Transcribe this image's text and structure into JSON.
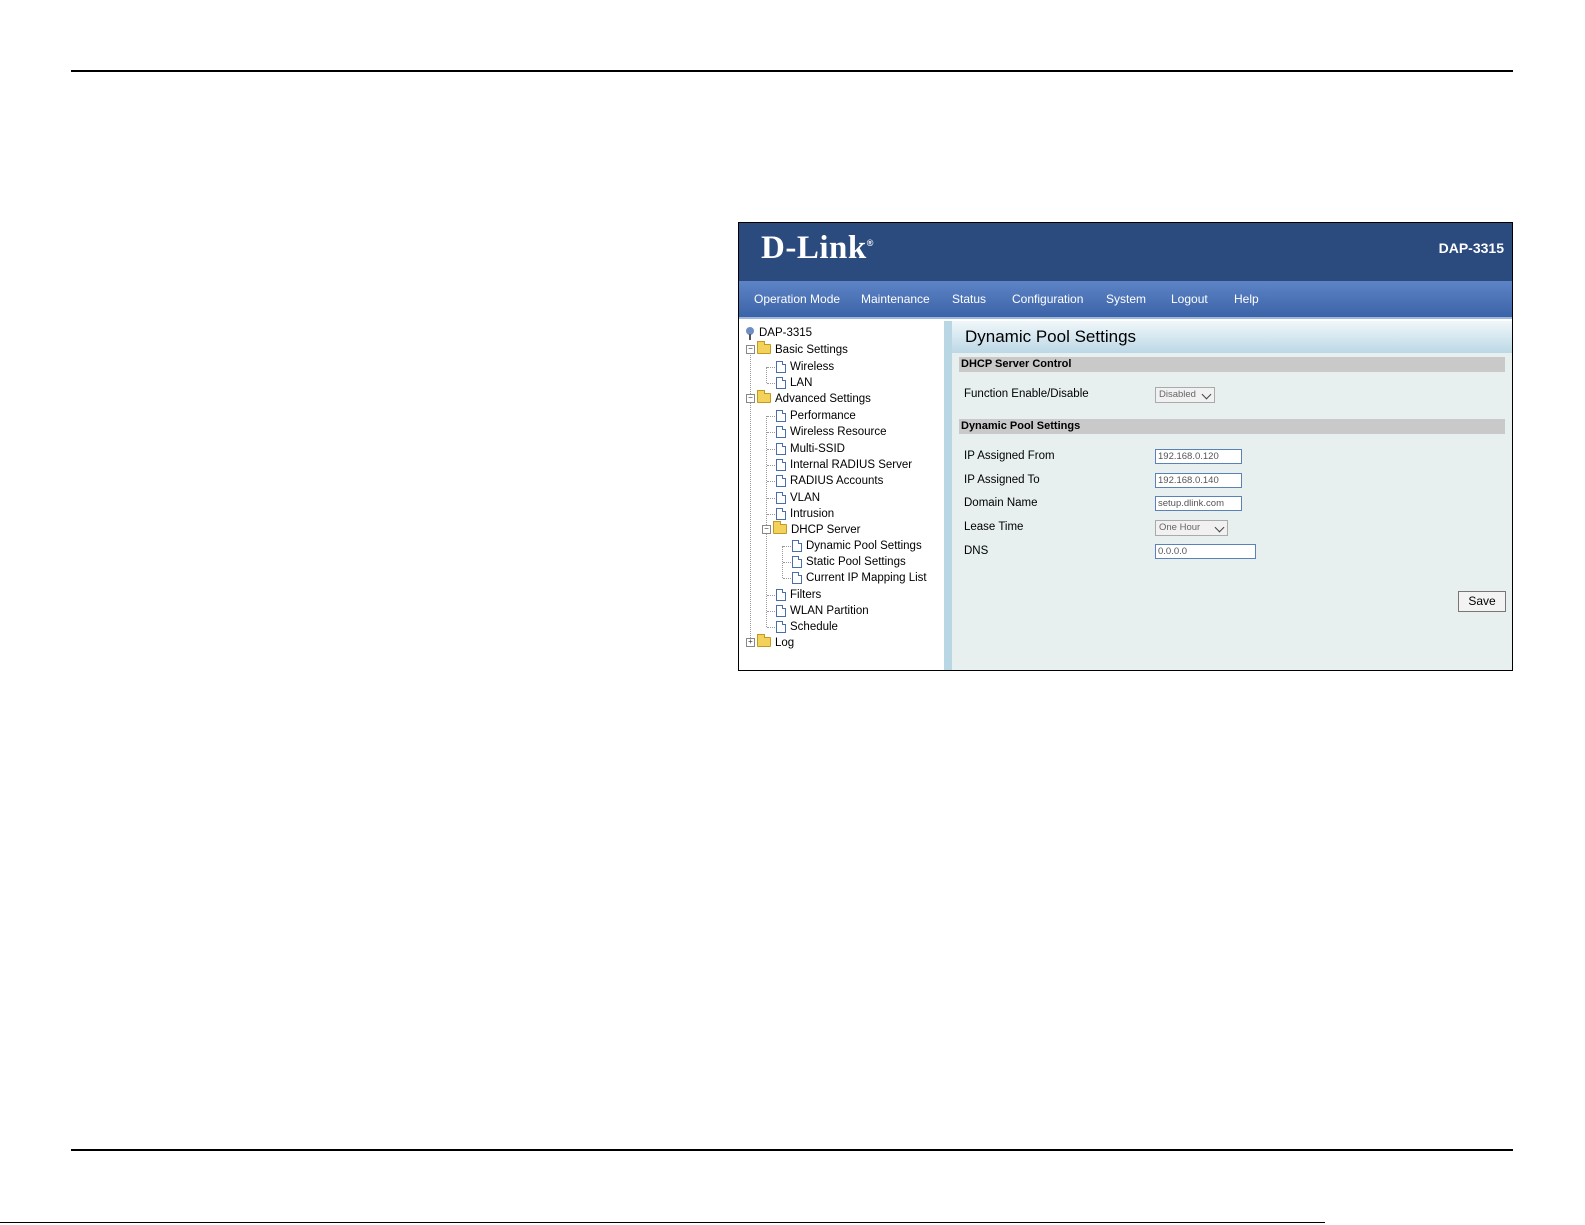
{
  "header": {
    "logo": "D-Link",
    "logo_mark": "®",
    "model": "DAP-3315"
  },
  "nav": [
    "Operation Mode",
    "Maintenance",
    "Status",
    "Configuration",
    "System",
    "Logout",
    "Help"
  ],
  "tree": {
    "root": "DAP-3315",
    "basic": "Basic Settings",
    "wireless": "Wireless",
    "lan": "LAN",
    "advanced": "Advanced Settings",
    "performance": "Performance",
    "wireless_resource": "Wireless Resource",
    "multi_ssid": "Multi-SSID",
    "internal_radius": "Internal RADIUS Server",
    "radius_accounts": "RADIUS Accounts",
    "vlan": "VLAN",
    "intrusion": "Intrusion",
    "dhcp_server": "DHCP Server",
    "dynamic_pool": "Dynamic Pool Settings",
    "static_pool": "Static Pool Settings",
    "ip_mapping": "Current IP Mapping List",
    "filters": "Filters",
    "wlan_partition": "WLAN Partition",
    "schedule": "Schedule",
    "log": "Log"
  },
  "content": {
    "title": "Dynamic Pool Settings",
    "section_control": "DHCP Server Control",
    "function_label": "Function Enable/Disable",
    "function_value": "Disabled",
    "section_pool": "Dynamic Pool Settings",
    "ip_from_label": "IP Assigned From",
    "ip_from_value": "192.168.0.120",
    "ip_to_label": "IP Assigned To",
    "ip_to_value": "192.168.0.140",
    "domain_label": "Domain Name",
    "domain_value": "setup.dlink.com",
    "lease_label": "Lease Time",
    "lease_value": "One Hour",
    "dns_label": "DNS",
    "dns_value": "0.0.0.0",
    "save_label": "Save"
  }
}
